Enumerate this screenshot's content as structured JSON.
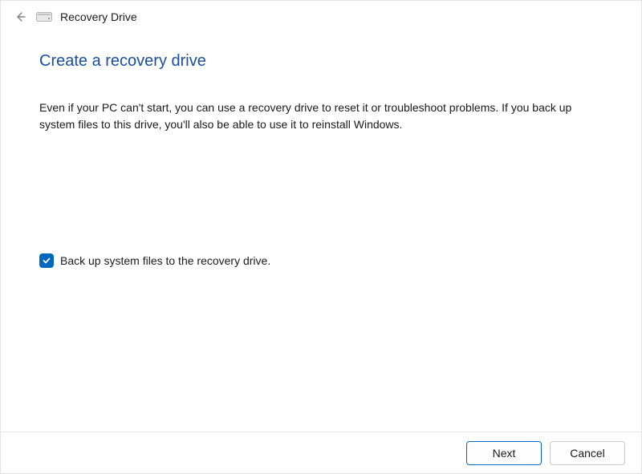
{
  "header": {
    "window_title": "Recovery Drive"
  },
  "main": {
    "page_title": "Create a recovery drive",
    "description": "Even if your PC can't start, you can use a recovery drive to reset it or troubleshoot problems. If you back up system files to this drive, you'll also be able to use it to reinstall Windows.",
    "checkbox_label": "Back up system files to the recovery drive.",
    "checkbox_checked": true
  },
  "footer": {
    "next_label": "Next",
    "cancel_label": "Cancel"
  },
  "colors": {
    "accent": "#0067c0",
    "title": "#1a4ea0"
  }
}
